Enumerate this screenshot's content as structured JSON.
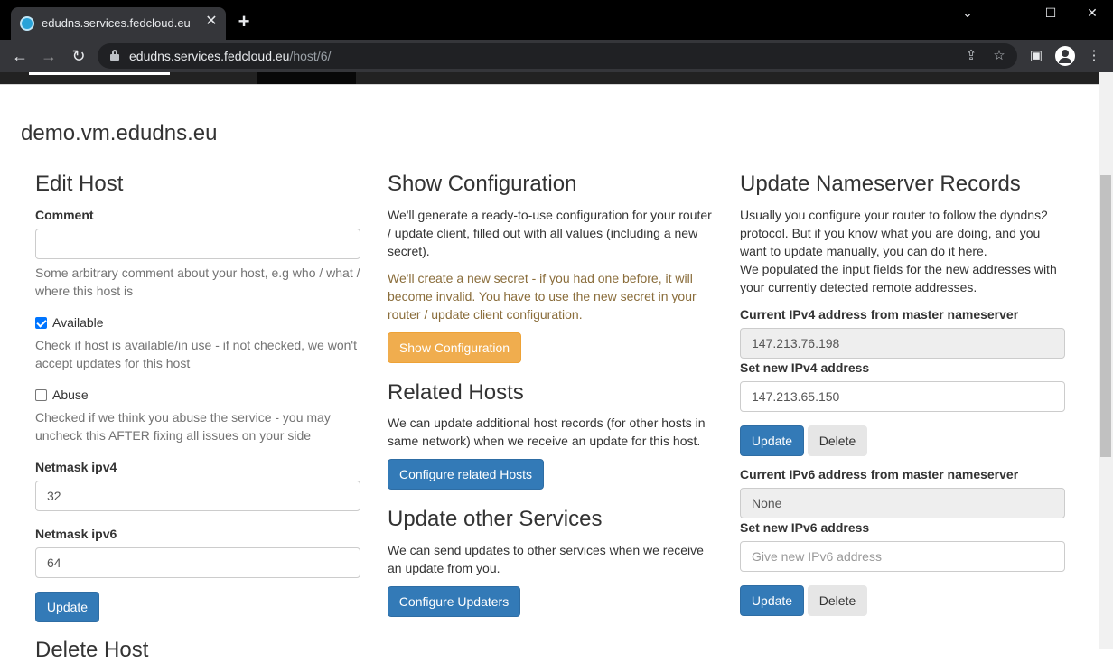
{
  "browser": {
    "tab_title": "edudns.services.fedcloud.eu",
    "tab_close": "✕",
    "new_tab": "+",
    "url_host": "edudns.services.fedcloud.eu",
    "url_path": "/host/6/",
    "window_controls": [
      "⌄",
      "—",
      "☐",
      "✕"
    ]
  },
  "page": {
    "title": "demo.vm.edudns.eu"
  },
  "edit_host": {
    "heading": "Edit Host",
    "comment_label": "Comment",
    "comment_value": "",
    "comment_help": "Some arbitrary comment about your host, e.g who / what / where this host is",
    "available_label": "Available",
    "available_checked": true,
    "available_help": "Check if host is available/in use - if not checked, we won't accept updates for this host",
    "abuse_label": "Abuse",
    "abuse_checked": false,
    "abuse_help": "Checked if we think you abuse the service - you may uncheck this AFTER fixing all issues on your side",
    "netmask4_label": "Netmask ipv4",
    "netmask4_value": "32",
    "netmask6_label": "Netmask ipv6",
    "netmask6_value": "64",
    "update_button": "Update",
    "next_heading": "Delete Host"
  },
  "show_config": {
    "heading": "Show Configuration",
    "para1": "We'll generate a ready-to-use configuration for your router / update client, filled out with all values (including a new secret).",
    "para2": "We'll create a new secret - if you had one before, it will become invalid. You have to use the new secret in your router / update client configuration.",
    "button": "Show Configuration"
  },
  "related_hosts": {
    "heading": "Related Hosts",
    "para": "We can update additional host records (for other hosts in same network) when we receive an update for this host.",
    "button": "Configure related Hosts"
  },
  "other_services": {
    "heading": "Update other Services",
    "para": "We can send updates to other services when we receive an update from you.",
    "button": "Configure Updaters"
  },
  "nameserver": {
    "heading": "Update Nameserver Records",
    "para1": "Usually you configure your router to follow the dyndns2 protocol. But if you know what you are doing, and you want to update manually, you can do it here.",
    "para2": "We populated the input fields for the new addresses with your currently detected remote addresses.",
    "current_v4_label": "Current IPv4 address from master nameserver",
    "current_v4_value": "147.213.76.198",
    "new_v4_label": "Set new IPv4 address",
    "new_v4_value": "147.213.65.150",
    "update_v4": "Update",
    "delete_v4": "Delete",
    "current_v6_label": "Current IPv6 address from master nameserver",
    "current_v6_value": "None",
    "new_v6_label": "Set new IPv6 address",
    "new_v6_placeholder": "Give new IPv6 address",
    "update_v6": "Update",
    "delete_v6": "Delete"
  }
}
